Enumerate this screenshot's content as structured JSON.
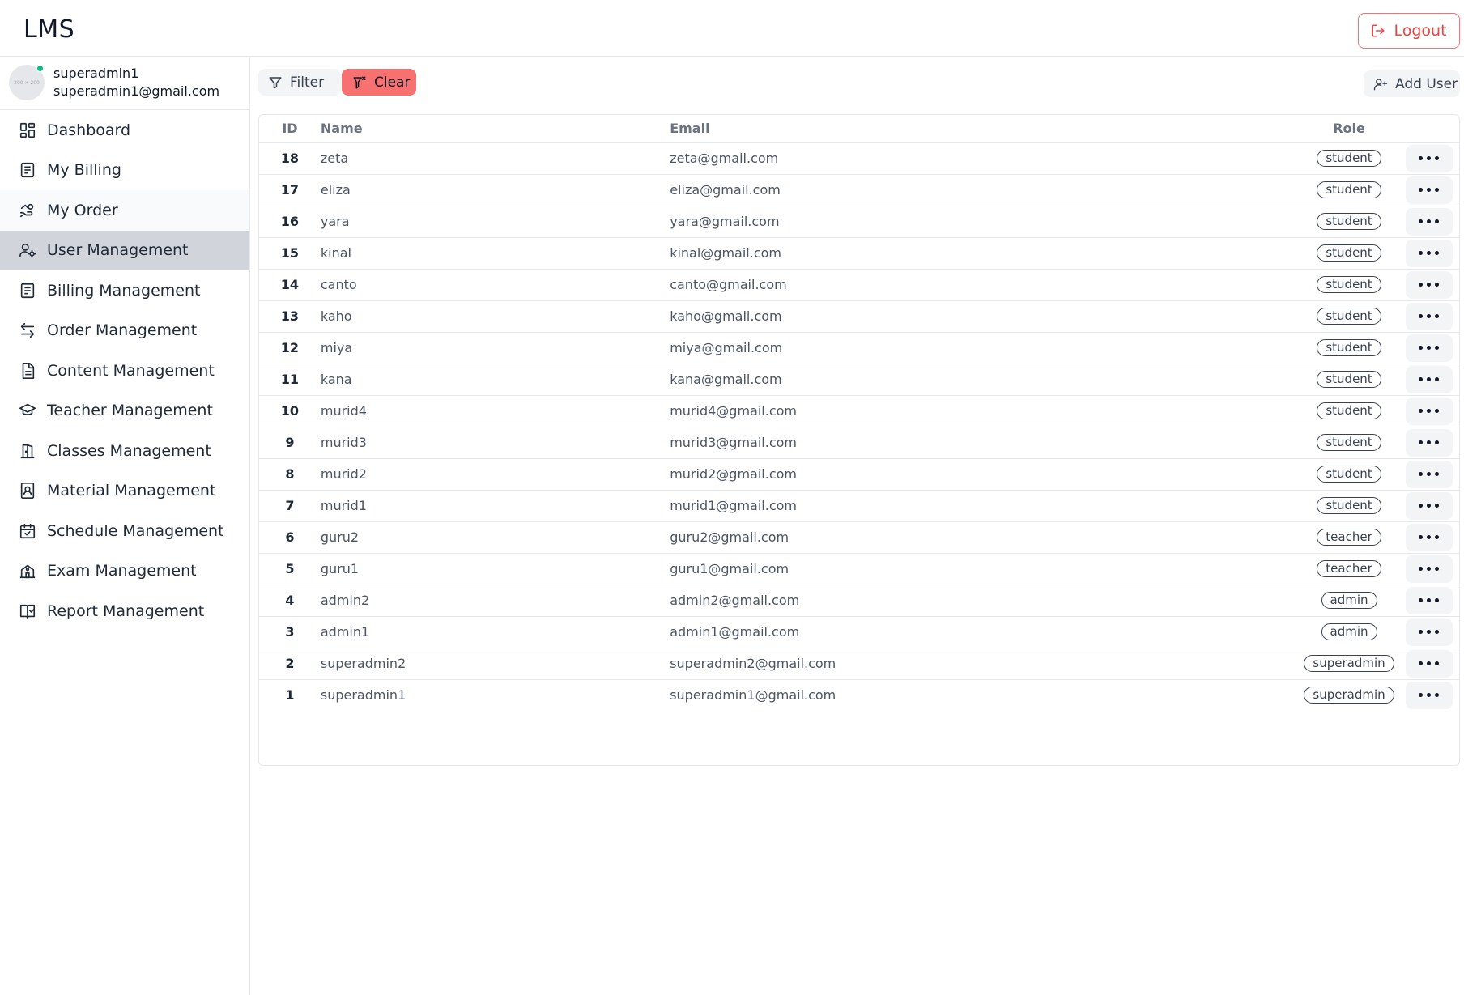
{
  "header": {
    "brand": "LMS",
    "logout_label": "Logout"
  },
  "profile": {
    "avatar_placeholder": "200 × 200",
    "name": "superadmin1",
    "email": "superadmin1@gmail.com",
    "status_color": "#10b981"
  },
  "sidebar": {
    "items": [
      {
        "label": "Dashboard",
        "icon": "dashboard-icon"
      },
      {
        "label": "My Billing",
        "icon": "receipt-icon"
      },
      {
        "label": "My Order",
        "icon": "hand-coins-icon"
      },
      {
        "label": "User Management",
        "icon": "user-gear-icon"
      },
      {
        "label": "Billing Management",
        "icon": "receipt-icon"
      },
      {
        "label": "Order Management",
        "icon": "swap-arrows-icon"
      },
      {
        "label": "Content Management",
        "icon": "document-icon"
      },
      {
        "label": "Teacher Management",
        "icon": "graduation-cap-icon"
      },
      {
        "label": "Classes Management",
        "icon": "door-icon"
      },
      {
        "label": "Material Management",
        "icon": "book-user-icon"
      },
      {
        "label": "Schedule Management",
        "icon": "calendar-check-icon"
      },
      {
        "label": "Exam Management",
        "icon": "school-icon"
      },
      {
        "label": "Report Management",
        "icon": "book-check-icon"
      }
    ],
    "active_index": 3,
    "active_color": "#d1d5db"
  },
  "toolbar": {
    "filter_label": "Filter",
    "clear_label": "Clear",
    "add_user_label": "Add User",
    "clear_color": "#f87171"
  },
  "table": {
    "headers": {
      "id": "ID",
      "name": "Name",
      "email": "Email",
      "role": "Role"
    },
    "rows": [
      {
        "id": "18",
        "name": "zeta",
        "email": "zeta@gmail.com",
        "role": "student"
      },
      {
        "id": "17",
        "name": "eliza",
        "email": "eliza@gmail.com",
        "role": "student"
      },
      {
        "id": "16",
        "name": "yara",
        "email": "yara@gmail.com",
        "role": "student"
      },
      {
        "id": "15",
        "name": "kinal",
        "email": "kinal@gmail.com",
        "role": "student"
      },
      {
        "id": "14",
        "name": "canto",
        "email": "canto@gmail.com",
        "role": "student"
      },
      {
        "id": "13",
        "name": "kaho",
        "email": "kaho@gmail.com",
        "role": "student"
      },
      {
        "id": "12",
        "name": "miya",
        "email": "miya@gmail.com",
        "role": "student"
      },
      {
        "id": "11",
        "name": "kana",
        "email": "kana@gmail.com",
        "role": "student"
      },
      {
        "id": "10",
        "name": "murid4",
        "email": "murid4@gmail.com",
        "role": "student"
      },
      {
        "id": "9",
        "name": "murid3",
        "email": "murid3@gmail.com",
        "role": "student"
      },
      {
        "id": "8",
        "name": "murid2",
        "email": "murid2@gmail.com",
        "role": "student"
      },
      {
        "id": "7",
        "name": "murid1",
        "email": "murid1@gmail.com",
        "role": "student"
      },
      {
        "id": "6",
        "name": "guru2",
        "email": "guru2@gmail.com",
        "role": "teacher"
      },
      {
        "id": "5",
        "name": "guru1",
        "email": "guru1@gmail.com",
        "role": "teacher"
      },
      {
        "id": "4",
        "name": "admin2",
        "email": "admin2@gmail.com",
        "role": "admin"
      },
      {
        "id": "3",
        "name": "admin1",
        "email": "admin1@gmail.com",
        "role": "admin"
      },
      {
        "id": "2",
        "name": "superadmin2",
        "email": "superadmin2@gmail.com",
        "role": "superadmin"
      },
      {
        "id": "1",
        "name": "superadmin1",
        "email": "superadmin1@gmail.com",
        "role": "superadmin"
      }
    ]
  }
}
